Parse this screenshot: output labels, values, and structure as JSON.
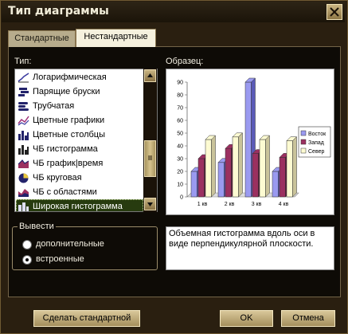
{
  "window": {
    "title": "Тип диаграммы"
  },
  "tabs": [
    {
      "label": "Стандартные"
    },
    {
      "label": "Нестандартные"
    }
  ],
  "type_label": "Тип:",
  "type_list": [
    {
      "label": "Логарифмическая",
      "icon": "log-chart-icon"
    },
    {
      "label": "Парящие бруски",
      "icon": "floating-bars-icon"
    },
    {
      "label": "Трубчатая",
      "icon": "tube-chart-icon"
    },
    {
      "label": "Цветные графики",
      "icon": "color-lines-icon"
    },
    {
      "label": "Цветные столбцы",
      "icon": "color-columns-icon"
    },
    {
      "label": "ЧБ гистограмма",
      "icon": "bw-histogram-icon"
    },
    {
      "label": "ЧБ график|время",
      "icon": "bw-line-time-icon"
    },
    {
      "label": "ЧБ круговая",
      "icon": "bw-pie-icon"
    },
    {
      "label": "ЧБ с областями",
      "icon": "bw-area-icon"
    },
    {
      "label": "Широкая гистограмма",
      "icon": "wide-histogram-icon",
      "selected": true
    }
  ],
  "sample_label": "Образец:",
  "output": {
    "legend": "Вывести",
    "option_additional": "дополнительные",
    "option_builtin": "встроенные",
    "selected": "builtin"
  },
  "description": "Объемная гистограмма вдоль оси в виде перпендикулярной плоскости.",
  "buttons": {
    "set_default": "Сделать стандартной",
    "ok": "OK",
    "cancel": "Отмена"
  },
  "chart_data": {
    "type": "bar",
    "categories": [
      "1 кв",
      "2 кв",
      "3 кв",
      "4 кв"
    ],
    "series": [
      {
        "name": "Восток",
        "values": [
          20,
          27,
          90,
          20
        ],
        "color": "#9a9af0"
      },
      {
        "name": "Запад",
        "values": [
          30,
          38,
          34,
          31
        ],
        "color": "#9b3060"
      },
      {
        "name": "Север",
        "values": [
          45,
          47,
          45,
          44
        ],
        "color": "#fdfbd2"
      }
    ],
    "ylim": [
      0,
      90
    ],
    "yticks": [
      0,
      10,
      20,
      30,
      40,
      50,
      60,
      70,
      80,
      90
    ],
    "legend_position": "right",
    "grid": false
  }
}
